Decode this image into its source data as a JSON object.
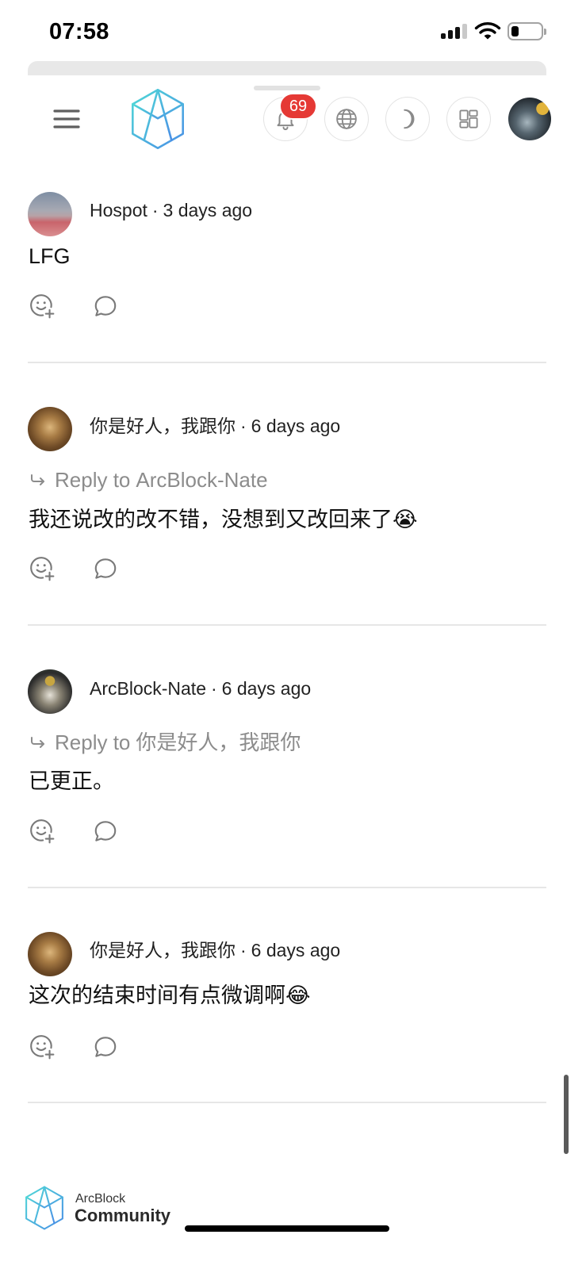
{
  "status_bar": {
    "time": "07:58",
    "signal_bars": 3,
    "signal_bars_total": 4,
    "battery_level": 0.25,
    "icons": [
      "cellular-signal-icon",
      "wifi-icon",
      "battery-icon"
    ]
  },
  "header": {
    "menu_icon": "hamburger-menu-icon",
    "logo_icon": "arcblock-logo",
    "notifications": {
      "icon": "bell-icon",
      "count": "69"
    },
    "language_icon": "globe-icon",
    "theme_icon": "moon-icon",
    "apps_icon": "grid-icon",
    "account_icon": "user-avatar"
  },
  "comments": {
    "separator": "·",
    "reply_label": "Reply to",
    "action_icons": [
      "add-reaction-icon",
      "reply-comment-icon"
    ],
    "items": [
      {
        "author": "Hospot",
        "time": "3 days ago",
        "body": "LFG"
      },
      {
        "author": "你是好人，我跟你",
        "time": "6 days ago",
        "reply_to": "ArcBlock-Nate",
        "body": "我还说改的改不错，没想到又改回来了😭"
      },
      {
        "author": "ArcBlock-Nate",
        "time": "6 days ago",
        "reply_to": "你是好人，我跟你",
        "body": "已更正。"
      },
      {
        "author": "你是好人，我跟你",
        "time": "6 days ago",
        "body": "这次的结束时间有点微调啊😂"
      }
    ]
  },
  "footer": {
    "logo_icon": "arcblock-logo",
    "brand_top": "ArcBlock",
    "brand_bottom": "Community"
  },
  "colors": {
    "brand_gradient_start": "#4fd8d6",
    "brand_gradient_end": "#4a8fe6",
    "badge": "#e53935",
    "text_primary": "#1a1a1a",
    "text_secondary": "#8c8c8c",
    "icon": "#7a7a7a",
    "divider": "#e6e6e6"
  }
}
